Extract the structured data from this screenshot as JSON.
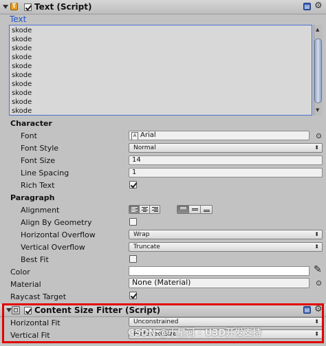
{
  "text_component": {
    "title": "Text (Script)",
    "text_label": "Text",
    "lines": [
      "skode",
      "skode",
      "skode",
      "skode",
      "skode",
      "skode",
      "skode",
      "skode",
      "skode",
      "skode"
    ],
    "character": {
      "header": "Character",
      "font_label": "Font",
      "font_value": "Arial",
      "font_style_label": "Font Style",
      "font_style_value": "Normal",
      "font_size_label": "Font Size",
      "font_size_value": "14",
      "line_spacing_label": "Line Spacing",
      "line_spacing_value": "1",
      "rich_text_label": "Rich Text",
      "rich_text_checked": true
    },
    "paragraph": {
      "header": "Paragraph",
      "alignment_label": "Alignment",
      "align_by_geometry_label": "Align By Geometry",
      "align_by_geometry_checked": false,
      "horizontal_overflow_label": "Horizontal Overflow",
      "horizontal_overflow_value": "Wrap",
      "vertical_overflow_label": "Vertical Overflow",
      "vertical_overflow_value": "Truncate",
      "best_fit_label": "Best Fit",
      "best_fit_checked": false
    },
    "color_label": "Color",
    "color_value": "#ffffff",
    "material_label": "Material",
    "material_value": "None (Material)",
    "raycast_target_label": "Raycast Target",
    "raycast_target_checked": true
  },
  "content_size_fitter": {
    "title": "Content Size Fitter (Script)",
    "horizontal_fit_label": "Horizontal Fit",
    "horizontal_fit_value": "Unconstrained",
    "vertical_fit_label": "Vertical Fit",
    "vertical_fit_value": "Preferred Size"
  },
  "watermark": "CSDN @小星河 - U3D开发支持",
  "icons": {
    "dropdown_arrow": "⬍",
    "gear": "⚙",
    "book": "▤",
    "eyedropper": "✎"
  },
  "colors": {
    "highlight": "#e00000",
    "text_blue": "#2255cc"
  }
}
